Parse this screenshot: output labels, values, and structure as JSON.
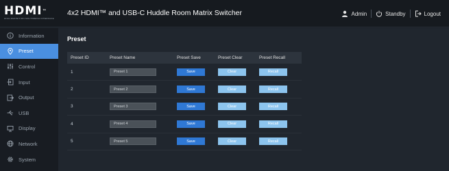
{
  "header": {
    "logo_text": "HDMI",
    "logo_mark": "™",
    "logo_subtitle": "HIGH-DEFINITION MULTIMEDIA INTERFACE",
    "title": "4x2 HDMI™ and USB-C Huddle Room Matrix Switcher",
    "user_label": "Admin",
    "standby_label": "Standby",
    "logout_label": "Logout"
  },
  "sidebar": {
    "items": [
      {
        "name": "information",
        "label": "Information",
        "icon": "info-icon",
        "active": false
      },
      {
        "name": "preset",
        "label": "Preset",
        "icon": "location-icon",
        "active": true
      },
      {
        "name": "control",
        "label": "Control",
        "icon": "sliders-icon",
        "active": false
      },
      {
        "name": "input",
        "label": "Input",
        "icon": "input-icon",
        "active": false
      },
      {
        "name": "output",
        "label": "Output",
        "icon": "output-icon",
        "active": false
      },
      {
        "name": "usb",
        "label": "USB",
        "icon": "usb-icon",
        "active": false
      },
      {
        "name": "display",
        "label": "Display",
        "icon": "monitor-icon",
        "active": false
      },
      {
        "name": "network",
        "label": "Network",
        "icon": "globe-icon",
        "active": false
      },
      {
        "name": "system",
        "label": "System",
        "icon": "gear-icon",
        "active": false
      }
    ]
  },
  "main": {
    "title": "Preset",
    "columns": [
      "Preset ID",
      "Preset Name",
      "Preset Save",
      "Preset Clear",
      "Preset Recall"
    ],
    "rows": [
      {
        "id": "1",
        "name": "Preset 1",
        "save": "Save",
        "clear": "Clear",
        "recall": "Recall"
      },
      {
        "id": "2",
        "name": "Preset 2",
        "save": "Save",
        "clear": "Clear",
        "recall": "Recall"
      },
      {
        "id": "3",
        "name": "Preset 3",
        "save": "Save",
        "clear": "Clear",
        "recall": "Recall"
      },
      {
        "id": "4",
        "name": "Preset 4",
        "save": "Save",
        "clear": "Clear",
        "recall": "Recall"
      },
      {
        "id": "5",
        "name": "Preset 5",
        "save": "Save",
        "clear": "Clear",
        "recall": "Recall"
      }
    ]
  },
  "colors": {
    "accent": "#4a8fe0",
    "save_button": "#2f78d4",
    "secondary_button": "#8cc4ee",
    "background": "#1c2128"
  }
}
